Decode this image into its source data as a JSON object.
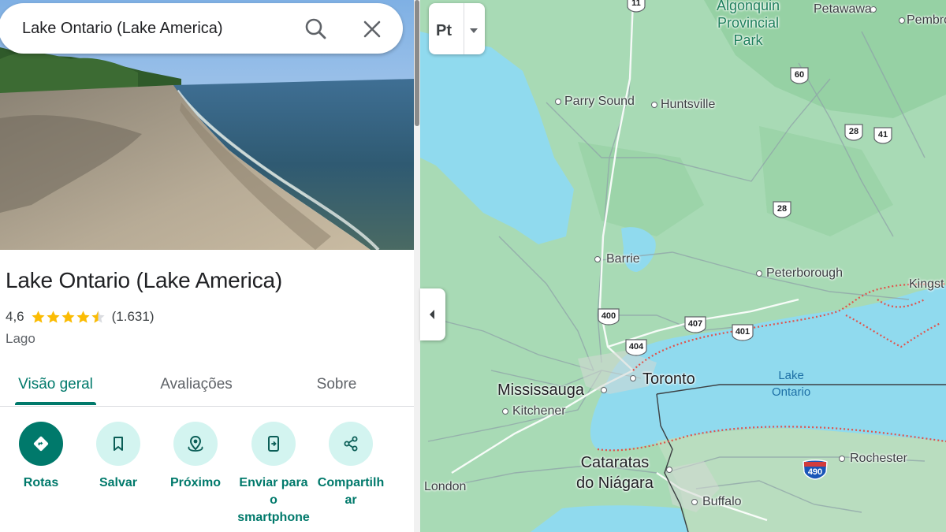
{
  "search": {
    "query": "Lake Ontario (Lake America)",
    "search_icon": "search-icon",
    "close_icon": "close-icon"
  },
  "place": {
    "title": "Lake Ontario (Lake America)",
    "rating": "4,6",
    "rating_fraction": 0.92,
    "stars_full": 4,
    "stars_half": 1,
    "review_count": "(1.631)",
    "category": "Lago"
  },
  "tabs": [
    {
      "label": "Visão geral",
      "active": true
    },
    {
      "label": "Avaliações",
      "active": false
    },
    {
      "label": "Sobre",
      "active": false
    }
  ],
  "actions": [
    {
      "label": "Rotas",
      "icon": "directions-icon"
    },
    {
      "label": "Salvar",
      "icon": "bookmark-icon"
    },
    {
      "label": "Próximo",
      "icon": "nearby-pin-icon"
    },
    {
      "label": "Enviar para o smartphone",
      "label_lines": [
        "Enviar para",
        "o",
        "smartphone"
      ],
      "icon": "send-to-phone-icon"
    },
    {
      "label": "Compartilhar",
      "label_lines": [
        "Compartilh",
        "ar"
      ],
      "icon": "share-icon"
    }
  ],
  "map": {
    "layer_button_label": "Pt",
    "labels": {
      "algonquin": [
        "Algonquin",
        "Provincial",
        "Park"
      ],
      "petawawa": "Petawawa",
      "pembroke": "Pembro",
      "parry_sound": "Parry Sound",
      "huntsville": "Huntsville",
      "barrie": "Barrie",
      "peterborough": "Peterborough",
      "kingston": "Kingst",
      "toronto": "Toronto",
      "mississauga": "Mississauga",
      "kitchener": "Kitchener",
      "lake_ontario": [
        "Lake",
        "Ontario"
      ],
      "niagara": [
        "Cataratas",
        "do Niágara"
      ],
      "rochester": "Rochester",
      "london": "London",
      "buffalo": "Buffalo"
    },
    "highways": [
      "11",
      "60",
      "28",
      "41",
      "28",
      "400",
      "407",
      "401",
      "404",
      "490"
    ]
  },
  "colors": {
    "accent": "#00796b",
    "accent_light": "#d3f4f0",
    "star": "#fbbc04",
    "map_land": "#a8dab5",
    "map_water": "#90daee",
    "border_dotted": "#e0534b"
  }
}
